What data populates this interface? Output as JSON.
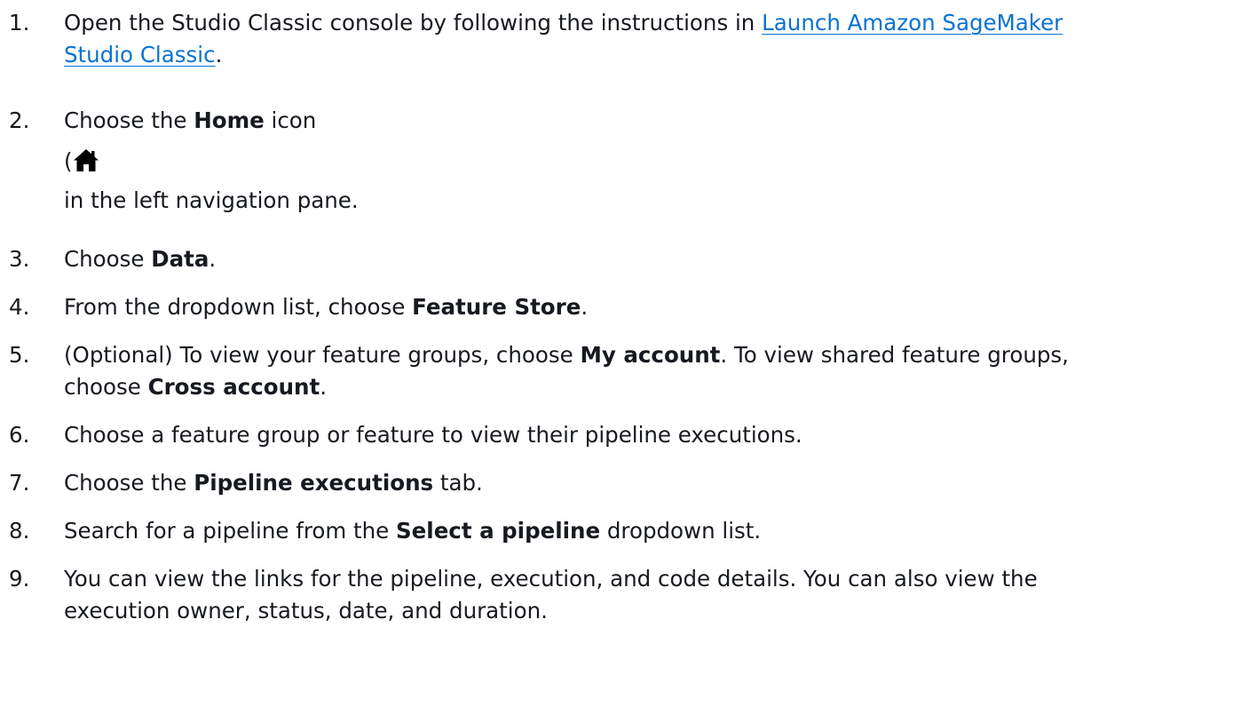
{
  "steps": [
    {
      "num": "1.",
      "line1_before": "Open the Studio Classic console by following the instructions in ",
      "link_part1": "Launch Amazon SageMaker",
      "link_part2": "Studio Classic",
      "line2_after": "."
    },
    {
      "num": "2.",
      "before": "Choose the ",
      "bold": "Home",
      "after": " icon",
      "icon_prefix": "(",
      "icon": "home-icon",
      "line3": "in the left navigation pane."
    },
    {
      "num": "3.",
      "before": "Choose ",
      "bold": "Data",
      "after": "."
    },
    {
      "num": "4.",
      "before": "From the dropdown list, choose ",
      "bold": "Feature Store",
      "after": "."
    },
    {
      "num": "5.",
      "before": "(Optional) To view your feature groups, choose ",
      "bold": "My account",
      "middle": ". To view shared feature groups,",
      "line2_before": "choose ",
      "bold2": "Cross account",
      "after": "."
    },
    {
      "num": "6.",
      "text": "Choose a feature group or feature to view their pipeline executions."
    },
    {
      "num": "7.",
      "before": "Choose the ",
      "bold": "Pipeline executions",
      "after": " tab."
    },
    {
      "num": "8.",
      "before": "Search for a pipeline from the ",
      "bold": "Select a pipeline",
      "after": " dropdown list."
    },
    {
      "num": "9.",
      "line1": "You can view the links for the pipeline, execution, and code details. You can also view the",
      "line2": "execution owner, status, date, and duration."
    }
  ],
  "colors": {
    "text": "#16191f",
    "link": "#0972d3",
    "icon": "#000000"
  }
}
